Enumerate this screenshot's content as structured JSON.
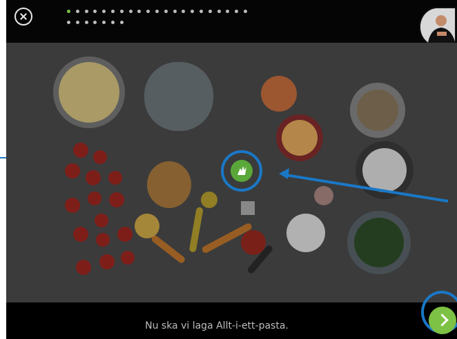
{
  "progress": {
    "total": 28,
    "current": 1
  },
  "subtitle": "Nu ska vi laga Allt-i-ett-pasta.",
  "icons": {
    "close": "close-icon",
    "next": "chevron-right-icon",
    "sign_language": "hand-sign-icon"
  },
  "colors": {
    "accent": "#7dc244",
    "highlight": "#1a78c7"
  }
}
